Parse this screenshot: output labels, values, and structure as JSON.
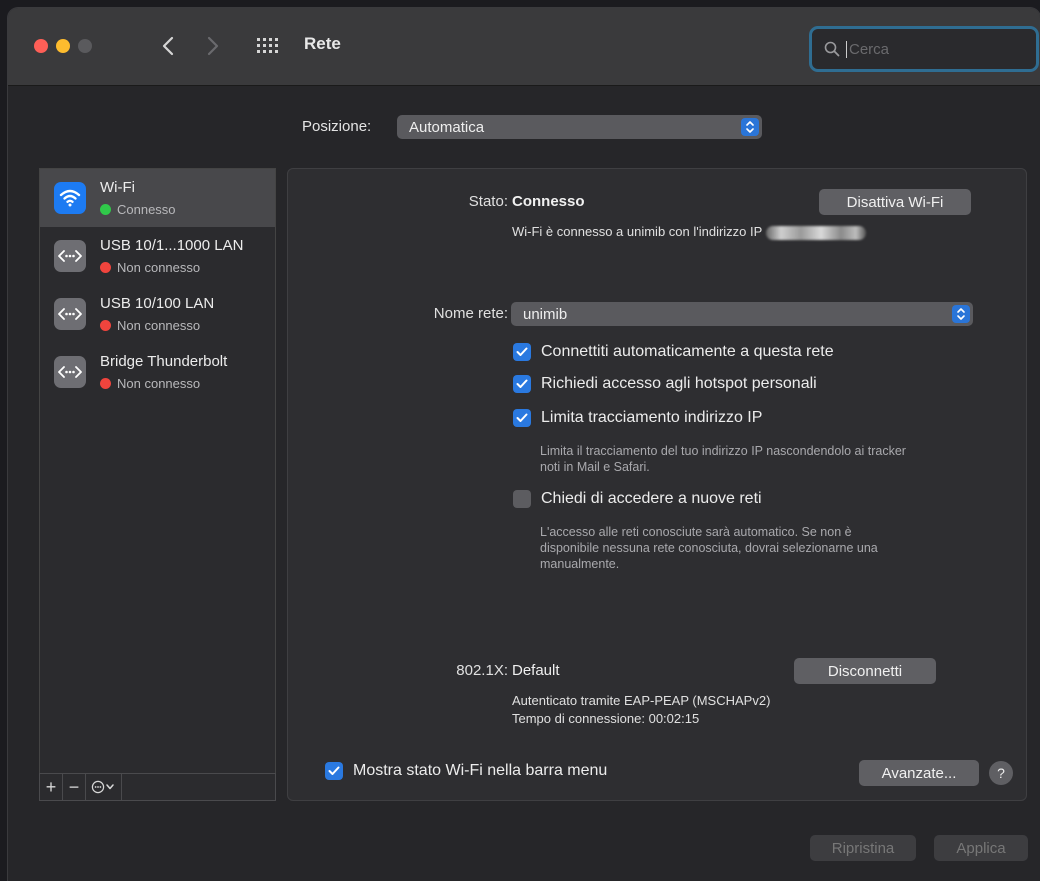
{
  "window": {
    "title": "Rete"
  },
  "search": {
    "placeholder": "Cerca"
  },
  "location": {
    "label": "Posizione:",
    "value": "Automatica"
  },
  "services": [
    {
      "name": "Wi-Fi",
      "status": "Connesso",
      "status_color": "#30c94a",
      "icon": "wifi-icon"
    },
    {
      "name": "USB 10/1...1000 LAN",
      "status": "Non connesso",
      "status_color": "#f0443d",
      "icon": "ethernet-icon"
    },
    {
      "name": "USB 10/100 LAN",
      "status": "Non connesso",
      "status_color": "#f0443d",
      "icon": "ethernet-icon"
    },
    {
      "name": "Bridge Thunderbolt",
      "status": "Non connesso",
      "status_color": "#f0443d",
      "icon": "ethernet-icon"
    }
  ],
  "sidebar_toolbar": {
    "add": "+",
    "remove": "−"
  },
  "detail": {
    "status_label": "Stato:",
    "status_value": "Connesso",
    "toggle_button": "Disattiva Wi-Fi",
    "status_desc": "Wi-Fi è connesso a unimib con l'indirizzo IP",
    "network_label": "Nome rete:",
    "network_value": "unimib",
    "options": [
      {
        "label": "Connettiti automaticamente a questa rete",
        "checked": true
      },
      {
        "label": "Richiedi accesso agli hotspot personali",
        "checked": true
      },
      {
        "label": "Limita tracciamento indirizzo IP",
        "checked": true
      },
      {
        "label": "Chiedi di accedere a nuove reti",
        "checked": false
      }
    ],
    "ip_note_1": "Limita il tracciamento del tuo indirizzo IP nascondendolo ai tracker",
    "ip_note_2": "noti in Mail e Safari.",
    "join_note_1": "L'accesso alle reti conosciute sarà automatico. Se non è",
    "join_note_2": "disponibile nessuna rete conosciuta, dovrai selezionarne una",
    "join_note_3": "manualmente.",
    "dot1x_label": "802.1X:",
    "dot1x_value": "Default",
    "disconnect_button": "Disconnetti",
    "auth_line": "Autenticato tramite EAP-PEAP (MSCHAPv2)",
    "time_line": "Tempo di connessione: 00:02:15",
    "show_menu_label": "Mostra stato Wi-Fi nella barra menu",
    "advanced_button": "Avanzate...",
    "help": "?"
  },
  "footer": {
    "revert": "Ripristina",
    "apply": "Applica"
  },
  "colors": {
    "accent": "#2a79e0",
    "connected": "#30c94a",
    "disconnected": "#f0443d"
  }
}
